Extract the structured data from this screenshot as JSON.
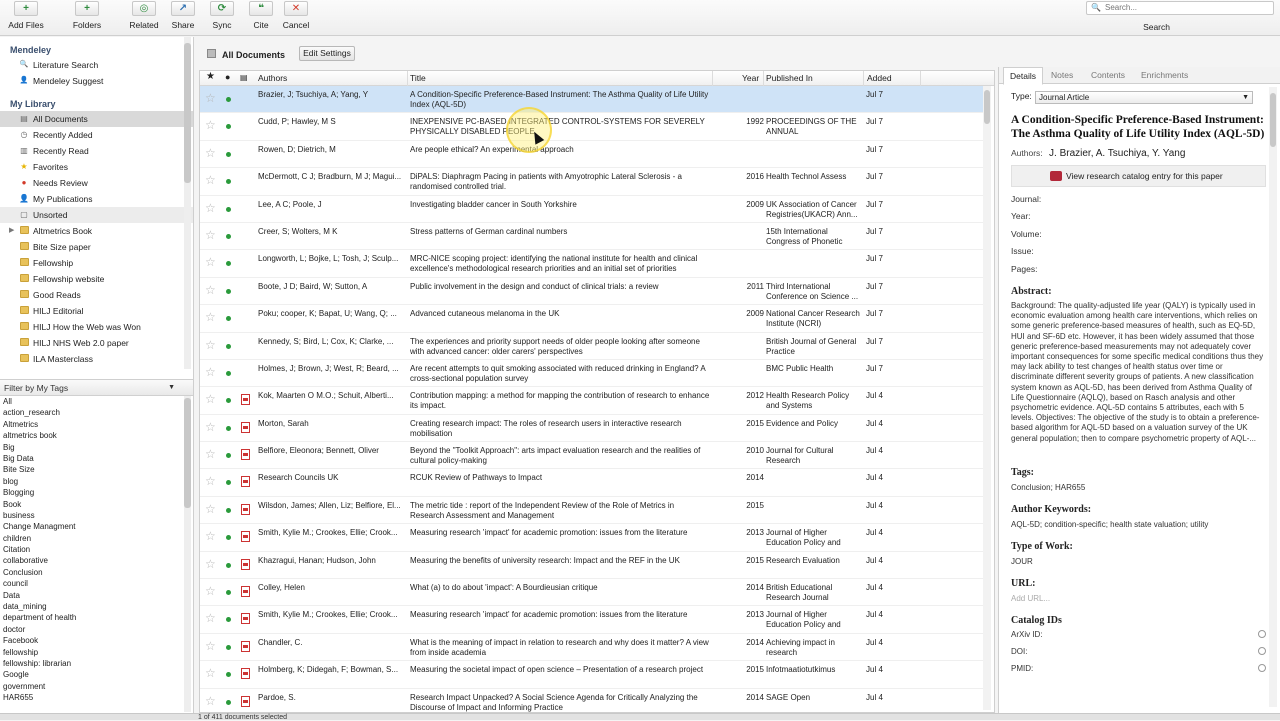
{
  "toolbar": {
    "buttons": [
      {
        "name": "add-files-button",
        "label": "Add Files",
        "icon": "+",
        "color": "#2e8b3e"
      },
      {
        "name": "folders-button",
        "label": "Folders",
        "icon": "+",
        "color": "#2e8b3e"
      },
      {
        "name": "related-button",
        "label": "Related",
        "icon": "◎",
        "color": "#2e8b3e"
      },
      {
        "name": "share-button",
        "label": "Share",
        "icon": "↗",
        "color": "#2d6fb0"
      },
      {
        "name": "sync-button",
        "label": "Sync",
        "icon": "⟳",
        "color": "#2e8b3e"
      },
      {
        "name": "cite-button",
        "label": "Cite",
        "icon": "❝",
        "color": "#2e8b3e"
      },
      {
        "name": "cancel-button",
        "label": "Cancel",
        "icon": "✕",
        "color": "#d23a2a"
      }
    ],
    "search_placeholder": "Search...",
    "search_label": "Search"
  },
  "library": {
    "mendeley_heading": "Mendeley",
    "mendeley_items": [
      {
        "label": "Literature Search",
        "icon": "🔍"
      },
      {
        "label": "Mendeley Suggest",
        "icon": "👤"
      }
    ],
    "my_library_heading": "My Library",
    "items": [
      {
        "label": "All Documents",
        "icon": "▤",
        "selected": true
      },
      {
        "label": "Recently Added",
        "icon": "◷"
      },
      {
        "label": "Recently Read",
        "icon": "▥"
      },
      {
        "label": "Favorites",
        "icon": "★",
        "icon_color": "#e6b400"
      },
      {
        "label": "Needs Review",
        "icon": "●",
        "icon_color": "#d23a2a"
      },
      {
        "label": "My Publications",
        "icon": "👤"
      },
      {
        "label": "Unsorted",
        "icon": "▢",
        "selected_light": true
      },
      {
        "label": "Altmetrics Book",
        "folder": true,
        "expandable": true
      },
      {
        "label": "Bite Size paper",
        "folder": true
      },
      {
        "label": "Fellowship",
        "folder": true
      },
      {
        "label": "Fellowship website",
        "folder": true
      },
      {
        "label": "Good Reads",
        "folder": true
      },
      {
        "label": "HILJ Editorial",
        "folder": true
      },
      {
        "label": "HILJ How the Web was Won",
        "folder": true
      },
      {
        "label": "HILJ NHS Web 2.0 paper",
        "folder": true
      },
      {
        "label": "ILA Masterclass",
        "folder": true
      }
    ]
  },
  "tags": {
    "header": "Filter by My Tags",
    "items": [
      "All",
      "action_research",
      "Altmetrics",
      "altmetrics book",
      "Big",
      "Big Data",
      "Bite Size",
      "blog",
      "Blogging",
      "Book",
      "business",
      "Change Managment",
      "children",
      "Citation",
      "collaborative",
      "Conclusion",
      "council",
      "Data",
      "data_mining",
      "department of health",
      "doctor",
      "Facebook",
      "fellowship",
      "fellowship: librarian",
      "Google",
      "government",
      "HAR655"
    ]
  },
  "center": {
    "title": "All Documents",
    "edit_settings": "Edit Settings",
    "columns": {
      "authors": "Authors",
      "title": "Title",
      "year": "Year",
      "published": "Published In",
      "added": "Added"
    },
    "rows": [
      {
        "authors": "Brazier, J; Tsuchiya, A; Yang, Y",
        "title": "A Condition-Specific Preference-Based Instrument: The Asthma Quality of Life Utility Index (AQL-5D)",
        "year": "",
        "published": "",
        "added": "Jul 7",
        "pdf": false,
        "selected": true
      },
      {
        "authors": "Cudd, P; Hawley, M S",
        "title": "INEXPENSIVE PC-BASED INTEGRATED CONTROL-SYSTEMS FOR SEVERELY PHYSICALLY DISABLED PEOPLE",
        "year": "1992",
        "published": "PROCEEDINGS OF THE ANNUAL INTERNATION...",
        "added": "Jul 7",
        "pdf": false
      },
      {
        "authors": "Rowen, D; Dietrich, M",
        "title": "Are people ethical? An experimental approach",
        "year": "",
        "published": "",
        "added": "Jul 7",
        "pdf": false
      },
      {
        "authors": "McDermott, C J; Bradburn, M J; Magui...",
        "title": "DiPALS: Diaphragm Pacing in patients with Amyotrophic Lateral Sclerosis - a randomised controlled trial.",
        "year": "2016",
        "published": "Health Technol Assess",
        "added": "Jul 7",
        "pdf": false
      },
      {
        "authors": "Lee, A C; Poole, J",
        "title": "Investigating bladder cancer in South Yorkshire",
        "year": "2009",
        "published": "UK Association of Cancer Registries(UKACR) Ann...",
        "added": "Jul 7",
        "pdf": false
      },
      {
        "authors": "Creer, S; Wolters, M K",
        "title": "Stress patterns of German cardinal numbers",
        "year": "",
        "published": "15th International Congress of Phonetic Sc...",
        "added": "Jul 7",
        "pdf": false
      },
      {
        "authors": "Longworth, L; Bojke, L; Tosh, J; Sculp...",
        "title": "MRC-NICE scoping project: identifying the national institute for health and clinical excellence's methodological research priorities and an initial set of priorities",
        "year": "",
        "published": "",
        "added": "Jul 7",
        "pdf": false
      },
      {
        "authors": "Boote, J D; Baird, W; Sutton, A",
        "title": "Public involvement in the design and conduct of clinical trials: a review",
        "year": "2011",
        "published": "Third International Conference on Science ...",
        "added": "Jul 7",
        "pdf": false
      },
      {
        "authors": "Poku; cooper, K; Bapat, U; Wang, Q; ...",
        "title": "Advanced cutaneous melanoma in the UK",
        "year": "2009",
        "published": "National Cancer Research Institute (NCRI)",
        "added": "Jul 7",
        "pdf": false
      },
      {
        "authors": "Kennedy, S; Bird, L; Cox, K; Clarke, ...",
        "title": "The experiences and priority support needs of older people looking after someone with advanced cancer: older carers' perspectives",
        "year": "",
        "published": "British Journal of General Practice",
        "added": "Jul 7",
        "pdf": false
      },
      {
        "authors": "Holmes, J; Brown, J; West, R; Beard, ...",
        "title": "Are recent attempts to quit smoking associated with reduced drinking in England? A cross-sectional population survey",
        "year": "",
        "published": "BMC Public Health",
        "added": "Jul 7",
        "pdf": false
      },
      {
        "authors": "Kok, Maarten O M.O.; Schuit, Alberti...",
        "title": "Contribution mapping: a method for mapping the contribution of research to enhance its impact.",
        "year": "2012",
        "published": "Health Research Policy and Systems",
        "added": "Jul 4",
        "pdf": true
      },
      {
        "authors": "Morton, Sarah",
        "title": "Creating research impact: The roles of research users in interactive research mobilisation",
        "year": "2015",
        "published": "Evidence and Policy",
        "added": "Jul 4",
        "pdf": true
      },
      {
        "authors": "Belfiore, Eleonora; Bennett, Oliver",
        "title": "Beyond the \"Toolkit Approach\": arts impact evaluation research and the realities of cultural policy-making",
        "year": "2010",
        "published": "Journal for Cultural Research",
        "added": "Jul 4",
        "pdf": true
      },
      {
        "authors": "Research Councils UK",
        "title": "RCUK Review of Pathways to Impact",
        "year": "2014",
        "published": "",
        "added": "Jul 4",
        "pdf": true
      },
      {
        "authors": "Wilsdon, James; Allen, Liz; Belfiore, El...",
        "title": "The metric tide : report of the Independent Review of the Role of Metrics in Research Assessment and Management",
        "year": "2015",
        "published": "",
        "added": "Jul 4",
        "pdf": true
      },
      {
        "authors": "Smith, Kylie M.; Crookes, Ellie; Crook...",
        "title": "Measuring research 'impact' for academic promotion: issues from the literature",
        "year": "2013",
        "published": "Journal of Higher Education Policy and Ma...",
        "added": "Jul 4",
        "pdf": true
      },
      {
        "authors": "Khazragui, Hanan; Hudson, John",
        "title": "Measuring the benefits of university research: Impact and the REF in the UK",
        "year": "2015",
        "published": "Research Evaluation",
        "added": "Jul 4",
        "pdf": true
      },
      {
        "authors": "Colley, Helen",
        "title": "What (a) to do about 'impact': A Bourdieusian critique",
        "year": "2014",
        "published": "British Educational Research Journal",
        "added": "Jul 4",
        "pdf": true
      },
      {
        "authors": "Smith, Kylie M.; Crookes, Ellie; Crook...",
        "title": "Measuring research 'impact' for academic promotion: issues from the literature",
        "year": "2013",
        "published": "Journal of Higher Education Policy and Ma...",
        "added": "Jul 4",
        "pdf": true
      },
      {
        "authors": "Chandler, C.",
        "title": "What is the meaning of impact in relation to research and why does it matter? A view from inside academia",
        "year": "2014",
        "published": "Achieving impact in research",
        "added": "Jul 4",
        "pdf": true
      },
      {
        "authors": "Holmberg, K; Didegah, F; Bowman, S...",
        "title": "Measuring the societal impact of open science – Presentation of a research project",
        "year": "2015",
        "published": "Infotmaatiotutkimus",
        "added": "Jul 4",
        "pdf": true
      },
      {
        "authors": "Pardoe, S.",
        "title": "Research Impact Unpacked? A Social Science Agenda for Critically Analyzing the Discourse of Impact and Informing Practice",
        "year": "2014",
        "published": "SAGE Open",
        "added": "Jul 4",
        "pdf": true
      }
    ]
  },
  "details": {
    "tabs": [
      "Details",
      "Notes",
      "Contents",
      "Enrichments"
    ],
    "type_label": "Type:",
    "type_value": "Journal Article",
    "title": "A Condition-Specific Preference-Based Instrument: The Asthma Quality of Life Utility Index (AQL-5D)",
    "authors_label": "Authors:",
    "authors": "J. Brazier, A. Tsuchiya, Y. Yang",
    "catalog_link": "View research catalog entry for this paper",
    "fields": [
      "Journal:",
      "Year:",
      "Volume:",
      "Issue:",
      "Pages:"
    ],
    "abstract_heading": "Abstract:",
    "abstract": "Background: The quality-adjusted life year (QALY) is typically used in economic evaluation among health care interventions, which relies on some generic preference-based measures of health, such as EQ-5D, HUI and SF-6D etc. However, it has been widely assumed that those generic preference-based measurements may not adequately cover important consequences for some specific medical conditions thus they may lack ability to test changes of health status over time or discriminate different severity groups of patients. A new classification system known as AQL-5D, has been derived from Asthma Quality of Life Questionnaire (AQLQ), based on Rasch analysis and other psychometric evidence. AQL-5D contains 5 attributes, each with 5 levels.    Objectives: The objective of the study is to obtain a preference-based algorithm for AQL-5D based on a valuation survey of the UK general population; then to compare psychometric property of AQL-...",
    "tags_heading": "Tags:",
    "tags_value": "Conclusion; HAR655",
    "keywords_heading": "Author Keywords:",
    "keywords_value": "AQL-5D; condition-specific; health state valuation; utility",
    "type_of_work_heading": "Type of Work:",
    "type_of_work_value": "JOUR",
    "url_heading": "URL:",
    "url_placeholder": "Add URL...",
    "catalog_heading": "Catalog IDs",
    "catalog_ids": [
      "ArXiv ID:",
      "DOI:",
      "PMID:"
    ]
  },
  "status": {
    "text": "1 of 411 documents selected"
  }
}
